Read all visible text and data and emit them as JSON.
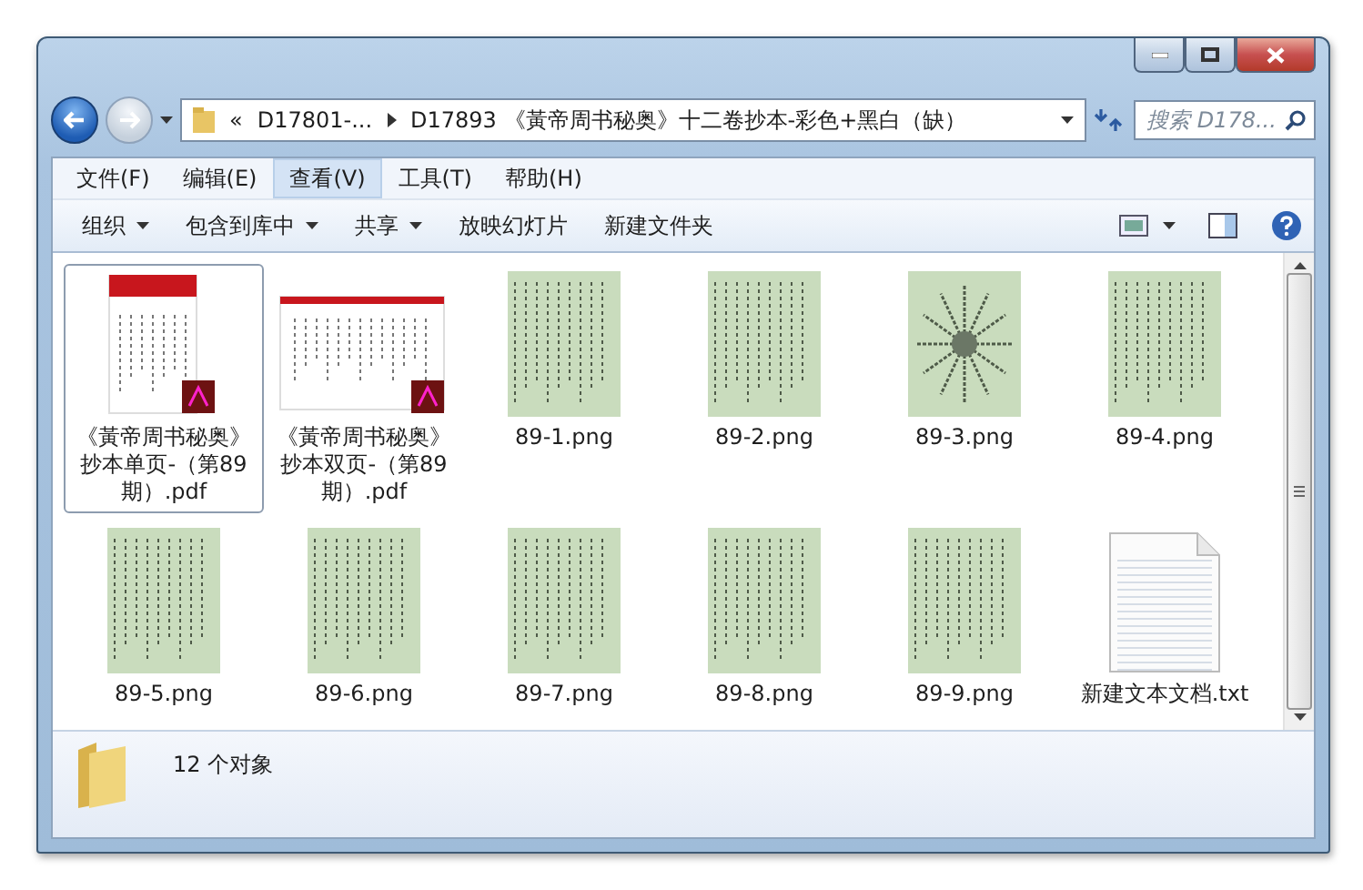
{
  "address": {
    "overflow": "«",
    "crumbs": [
      "D17801-...",
      "D17893 《黃帝周书秘奥》十二卷抄本-彩色+黑白（缺）"
    ]
  },
  "search": {
    "placeholder": "搜索 D178..."
  },
  "menu": [
    {
      "label": "文件(F)",
      "selected": false
    },
    {
      "label": "编辑(E)",
      "selected": false
    },
    {
      "label": "查看(V)",
      "selected": true
    },
    {
      "label": "工具(T)",
      "selected": false
    },
    {
      "label": "帮助(H)",
      "selected": false
    }
  ],
  "toolbar": [
    {
      "label": "组织",
      "dropdown": true
    },
    {
      "label": "包含到库中",
      "dropdown": true
    },
    {
      "label": "共享",
      "dropdown": true
    },
    {
      "label": "放映幻灯片",
      "dropdown": false
    },
    {
      "label": "新建文件夹",
      "dropdown": false
    }
  ],
  "files": [
    {
      "kind": "pdf",
      "name": "《黃帝周书秘奥》抄本单页-（第89期）.pdf",
      "selected": true
    },
    {
      "kind": "pdfwide",
      "name": "《黃帝周书秘奥》抄本双页-（第89期）.pdf",
      "selected": false
    },
    {
      "kind": "image",
      "name": "89-1.png",
      "selected": false
    },
    {
      "kind": "image",
      "name": "89-2.png",
      "selected": false
    },
    {
      "kind": "diagram",
      "name": "89-3.png",
      "selected": false
    },
    {
      "kind": "image",
      "name": "89-4.png",
      "selected": false
    },
    {
      "kind": "image",
      "name": "89-5.png",
      "selected": false
    },
    {
      "kind": "image",
      "name": "89-6.png",
      "selected": false
    },
    {
      "kind": "image",
      "name": "89-7.png",
      "selected": false
    },
    {
      "kind": "image",
      "name": "89-8.png",
      "selected": false
    },
    {
      "kind": "image",
      "name": "89-9.png",
      "selected": false
    },
    {
      "kind": "text",
      "name": "新建文本文档.txt",
      "selected": false
    }
  ],
  "status": {
    "count": "12 个对象"
  }
}
